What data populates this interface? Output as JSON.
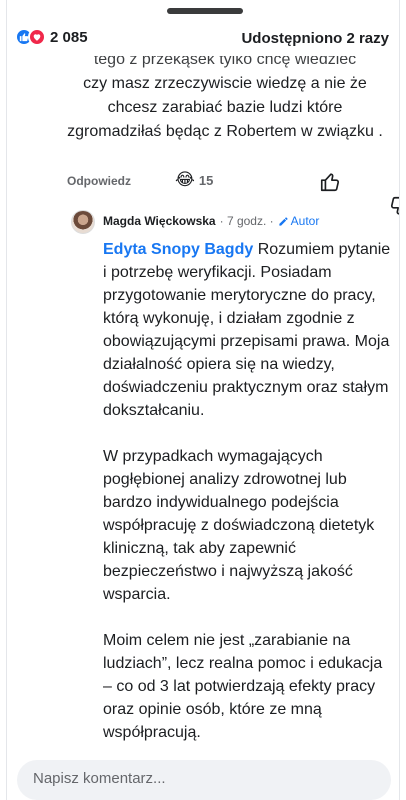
{
  "colors": {
    "link": "#1877f2",
    "like": "#1877f2",
    "love": "#f0284a",
    "muted": "#65676b"
  },
  "post": {
    "reactions_count": "2 085",
    "reaction_icons": [
      "like-icon",
      "love-icon"
    ],
    "shares": "Udostępniono 2 razy"
  },
  "comment": {
    "partial_line": "tego z przekąsek tylko chcę wiedzieć",
    "text": "czy masz zrzeczywiscie wiedzę a nie że chcesz zarabiać bazie ludzi które zgromadziłaś będąc z Robertem w związku .",
    "reply_label": "Odpowiedz",
    "reaction_emoji": "😂",
    "reaction_count": "15"
  },
  "reply": {
    "author": "Magda Więckowska",
    "time": "· 7 godz. ·",
    "badge": "Autor",
    "mention": "Edyta Snopy Bagdy",
    "paragraphs": [
      "Rozumiem pytanie i potrzebę weryfikacji. Posiadam przygotowanie merytoryczne do pracy, którą wykonuję, i działam zgodnie z obowiązującymi przepisami prawa. Moja działalność opiera się na wiedzy, doświadczeniu praktycznym oraz stałym dokształcaniu.",
      "W przypadkach wymagających pogłębionej analizy zdrowotnej lub bardzo indywidualnego podejścia współpracuję z doświadczoną dietetyk kliniczną, tak aby zapewnić bezpieczeństwo i najwyższą jakość wsparcia.",
      "Moim celem nie jest „zarabianie na ludziach”, lecz realna pomoc i edukacja – co od 3 lat potwierdzają efekty pracy oraz opinie osób, które ze mną współpracują."
    ]
  },
  "composer": {
    "placeholder": "Napisz komentarz..."
  }
}
